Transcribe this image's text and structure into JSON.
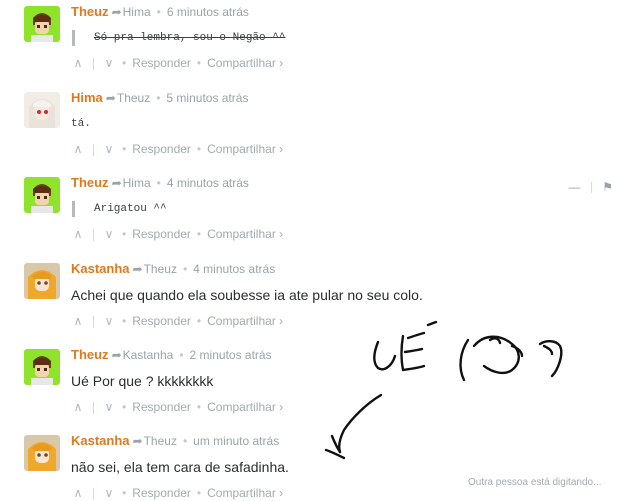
{
  "comments": [
    {
      "author": "Theuz",
      "parent": "Hima",
      "time": "6 minutos atrás",
      "text": "Só pra lembra, sou o Negão ^^",
      "style": "mono-quote-strike"
    },
    {
      "author": "Hima",
      "parent": "Theuz",
      "time": "5 minutos atrás",
      "text": "tá.",
      "style": "mono"
    },
    {
      "author": "Theuz",
      "parent": "Hima",
      "time": "4 minutos atrás",
      "text": "Arigatou ^^",
      "style": "mono-quote"
    },
    {
      "author": "Kastanha",
      "parent": "Theuz",
      "time": "4 minutos atrás",
      "text": "Achei que quando ela soubesse ia ate pular no seu colo.",
      "style": "sans"
    },
    {
      "author": "Theuz",
      "parent": "Kastanha",
      "time": "2 minutos atrás",
      "text": "Ué Por que ? kkkkkkkk",
      "style": "sans"
    },
    {
      "author": "Kastanha",
      "parent": "Theuz",
      "time": "um minuto atrás",
      "text": "não sei, ela tem cara de safadinha.",
      "style": "sans"
    }
  ],
  "actions": {
    "upvote": "∧",
    "downvote": "∨",
    "reply": "Responder",
    "share": "Compartilhar ›"
  },
  "moderation": {
    "collapse": "—",
    "flag": "⚑"
  },
  "typing_indicator": "Outra pessoa está digitando...",
  "colors": {
    "author": "#e0781e",
    "meta": "#9aa3a8",
    "text": "#2a2e2e",
    "theuz_avatar_bg": "#8fe32a",
    "hima_avatar_bg": "#f1ece6",
    "kastanha_avatar_bg": "#d8c8a8"
  }
}
